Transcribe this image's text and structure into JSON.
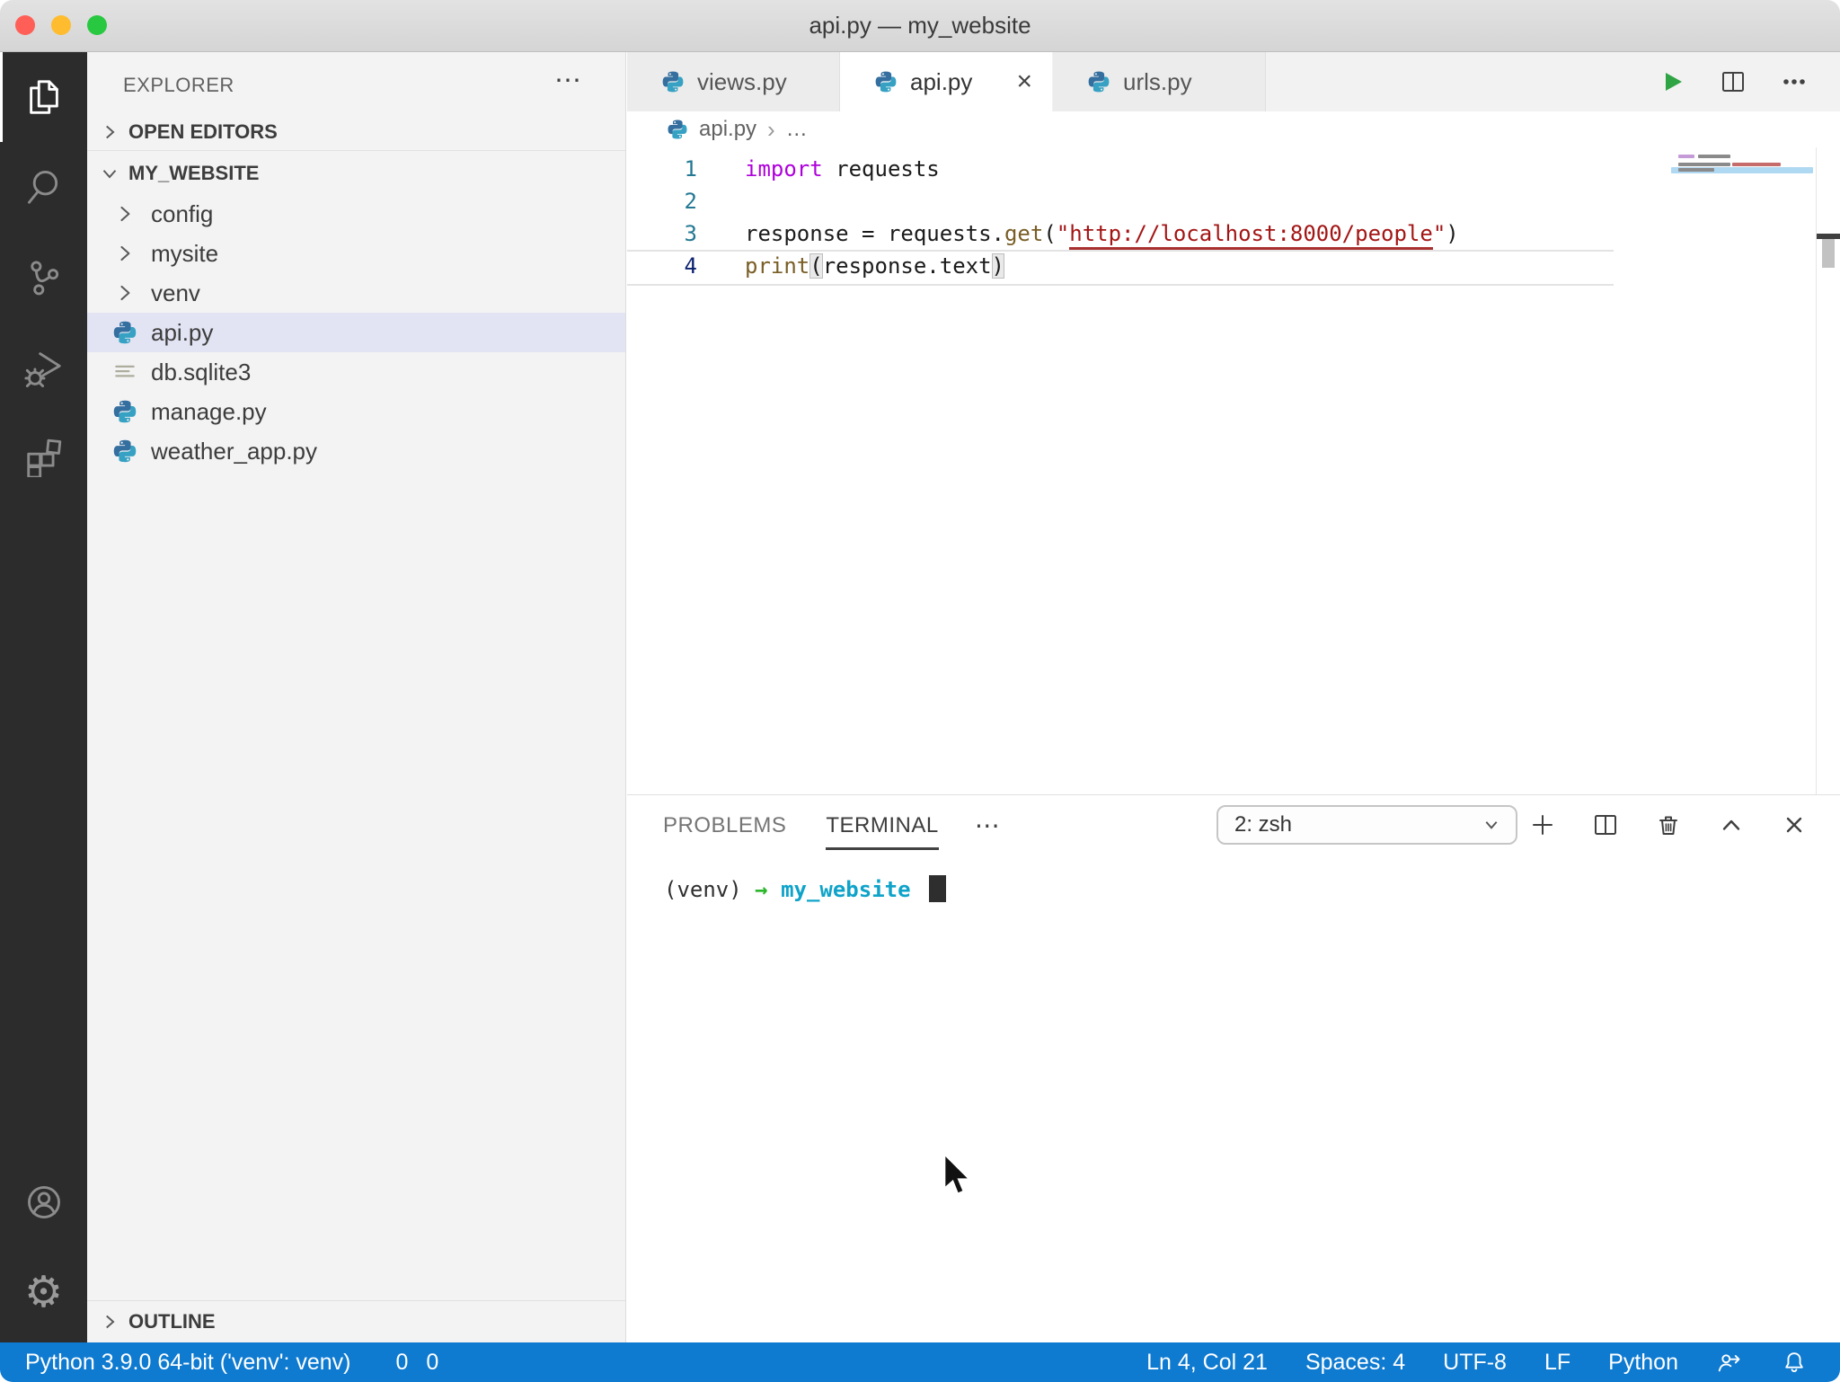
{
  "window": {
    "title": "api.py — my_website"
  },
  "traffic_lights": {
    "close": "#FF5F57",
    "minimize": "#FEBC2E",
    "zoom": "#28C840"
  },
  "activity_bar": {
    "top": [
      {
        "id": "explorer",
        "icon": "files-icon",
        "active": true
      },
      {
        "id": "search",
        "icon": "search-icon",
        "active": false
      },
      {
        "id": "source-control",
        "icon": "source-control-icon",
        "active": false
      },
      {
        "id": "run-debug",
        "icon": "run-debug-icon",
        "active": false
      },
      {
        "id": "extensions",
        "icon": "extensions-icon",
        "active": false
      }
    ],
    "bottom": [
      {
        "id": "account",
        "icon": "account-icon"
      },
      {
        "id": "settings",
        "icon": "gear-icon"
      }
    ]
  },
  "sidebar": {
    "title": "EXPLORER",
    "more_label": "⋯",
    "open_editors_label": "OPEN EDITORS",
    "workspace_label": "MY_WEBSITE",
    "outline_label": "OUTLINE",
    "tree": [
      {
        "label": "config",
        "kind": "folder"
      },
      {
        "label": "mysite",
        "kind": "folder"
      },
      {
        "label": "venv",
        "kind": "folder"
      },
      {
        "label": "api.py",
        "kind": "python",
        "selected": true
      },
      {
        "label": "db.sqlite3",
        "kind": "database"
      },
      {
        "label": "manage.py",
        "kind": "python"
      },
      {
        "label": "weather_app.py",
        "kind": "python"
      }
    ]
  },
  "editor": {
    "tabs": [
      {
        "label": "views.py",
        "active": false
      },
      {
        "label": "api.py",
        "active": true,
        "close_label": "×"
      },
      {
        "label": "urls.py",
        "active": false
      }
    ],
    "actions": [
      "run-icon",
      "split-editor-icon",
      "more-actions-icon"
    ],
    "breadcrumb": {
      "file": "api.py",
      "separator": "›",
      "tail": "…"
    },
    "code_lines": [
      {
        "number": "1",
        "tokens": [
          {
            "text": "import",
            "type": "keyword"
          },
          {
            "text": " requests",
            "type": "plain"
          }
        ]
      },
      {
        "number": "2",
        "tokens": []
      },
      {
        "number": "3",
        "tokens": [
          {
            "text": "response = requests.",
            "type": "plain"
          },
          {
            "text": "get",
            "type": "function"
          },
          {
            "text": "(",
            "type": "plain"
          },
          {
            "text": "\"",
            "type": "string"
          },
          {
            "text": "http://localhost:8000/people",
            "type": "string-link"
          },
          {
            "text": "\"",
            "type": "string"
          },
          {
            "text": ")",
            "type": "plain"
          }
        ]
      },
      {
        "number": "4",
        "current": true,
        "tokens": [
          {
            "text": "print",
            "type": "function"
          },
          {
            "text": "(",
            "type": "bracket-match"
          },
          {
            "text": "response.text",
            "type": "plain"
          },
          {
            "text": ")",
            "type": "bracket-match"
          }
        ]
      }
    ]
  },
  "panel": {
    "tabs": [
      {
        "label": "PROBLEMS",
        "active": false
      },
      {
        "label": "TERMINAL",
        "active": true
      }
    ],
    "more_label": "⋯",
    "shell_select": {
      "value": "2: zsh"
    },
    "actions": [
      "new-terminal-icon",
      "split-terminal-icon",
      "kill-terminal-icon",
      "maximize-panel-icon",
      "close-panel-icon"
    ],
    "terminal": {
      "venv": "(venv)",
      "arrow": "→",
      "cwd": "my_website"
    }
  },
  "status_bar": {
    "python_label": "Python 3.9.0 64-bit ('venv': venv)",
    "errors": "0",
    "warnings": "0",
    "right_items": [
      "Ln 4, Col 21",
      "Spaces: 4",
      "UTF-8",
      "LF",
      "Python"
    ],
    "right_icons": [
      "feedback-icon",
      "bell-icon"
    ]
  },
  "colors": {
    "status_bar_bg": "#0E7AD0",
    "keyword": "#AF00DB",
    "string": "#A31515",
    "function_call": "#795E26",
    "terminal_arrow": "#2BB62B",
    "terminal_cwd": "#0FA3C9",
    "selection_bg": "#E2E4F3",
    "run_button": "#2EA445"
  }
}
